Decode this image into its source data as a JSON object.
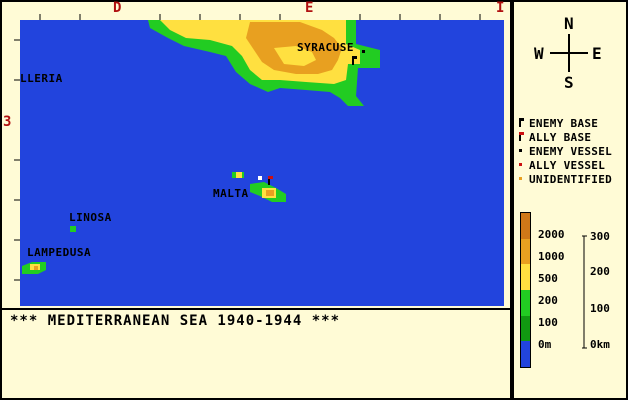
{
  "map": {
    "columns": [
      "D",
      "E",
      "I"
    ],
    "rows": [
      "3"
    ],
    "places": {
      "syracuse": "SYRACUSE",
      "pantelleria": "LLERIA",
      "malta": "MALTA",
      "linosa": "LINOSA",
      "lampedusa": "LAMPEDUSA"
    },
    "colors": {
      "sea": "#2244dd",
      "lowland": "#22cc22",
      "midland": "#ffe040",
      "highland": "#e8a020",
      "enemy": "#000000",
      "ally": "#cc1010",
      "unidentified": "#e8a020"
    }
  },
  "compass": {
    "n": "N",
    "e": "E",
    "s": "S",
    "w": "W"
  },
  "legend": {
    "enemy_base": "ENEMY BASE",
    "ally_base": "ALLY BASE",
    "enemy_vessel": "ENEMY VESSEL",
    "ally_vessel": "ALLY VESSEL",
    "unidentified": "UNIDENTIFIED"
  },
  "elevation": {
    "labels": [
      "2000",
      "1000",
      "500",
      "200",
      "100",
      "0m"
    ],
    "colors": [
      "#d07818",
      "#e8a020",
      "#ffe040",
      "#22cc22",
      "#119911",
      "#2244dd"
    ]
  },
  "scale": {
    "labels": [
      "300",
      "200",
      "100",
      "0km"
    ]
  },
  "message": "*** MEDITERRANEAN SEA 1940-1944 ***"
}
